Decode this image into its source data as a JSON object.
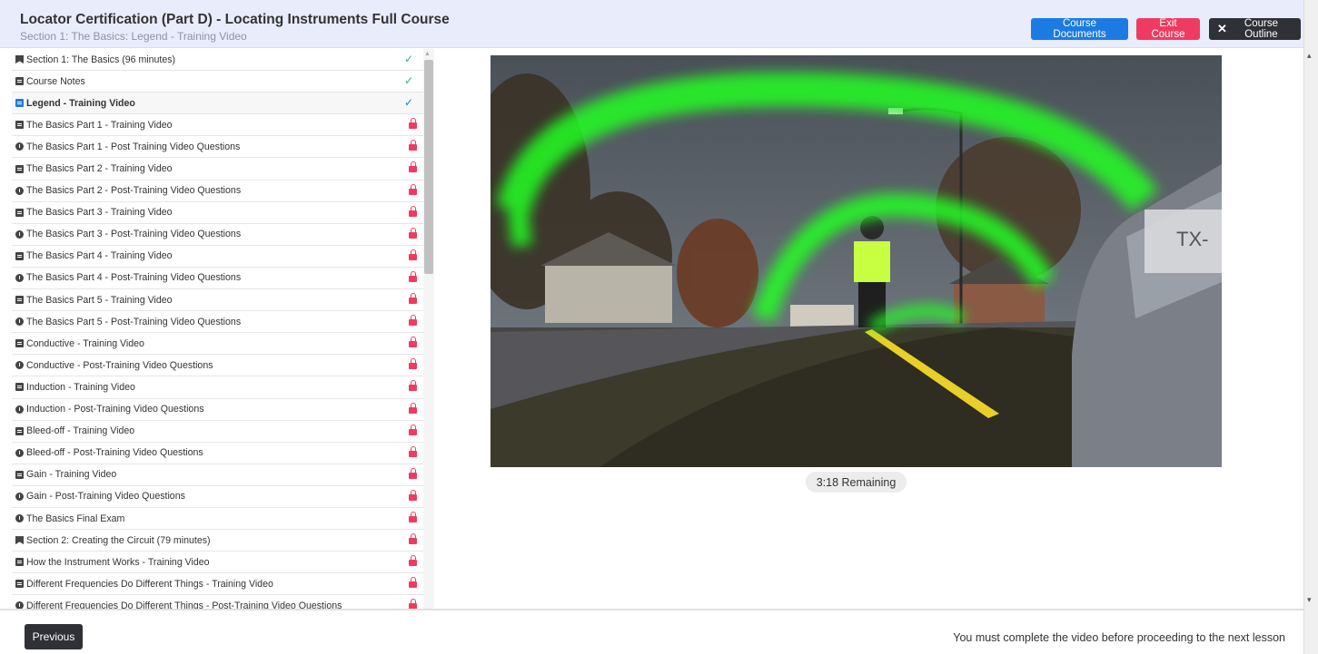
{
  "header": {
    "title": "Locator Certification (Part D) - Locating Instruments Full Course",
    "subtitle": "Section 1: The Basics: Legend - Training Video",
    "course_documents_label": "Course Documents",
    "exit_course_label": "Exit Course",
    "course_outline_label": "Course Outline"
  },
  "lessons": [
    {
      "label": "Section 1: The Basics (96 minutes)",
      "icon": "flag",
      "status": "check"
    },
    {
      "label": "Course Notes",
      "icon": "doc",
      "status": "check"
    },
    {
      "label": "Legend - Training Video",
      "icon": "doc",
      "status": "current"
    },
    {
      "label": "The Basics Part 1 - Training Video",
      "icon": "doc",
      "status": "locked"
    },
    {
      "label": "The Basics Part 1 - Post Training Video Questions",
      "icon": "quiz",
      "status": "locked"
    },
    {
      "label": "The Basics Part 2 - Training Video",
      "icon": "doc",
      "status": "locked"
    },
    {
      "label": "The Basics Part 2 - Post-Training Video Questions",
      "icon": "quiz",
      "status": "locked"
    },
    {
      "label": "The Basics Part 3 - Training Video",
      "icon": "doc",
      "status": "locked"
    },
    {
      "label": "The Basics Part 3 - Post-Training Video Questions",
      "icon": "quiz",
      "status": "locked"
    },
    {
      "label": "The Basics Part 4 - Training Video",
      "icon": "doc",
      "status": "locked"
    },
    {
      "label": "The Basics Part 4 - Post-Training Video Questions",
      "icon": "quiz",
      "status": "locked"
    },
    {
      "label": "The Basics Part 5 - Training Video",
      "icon": "doc",
      "status": "locked"
    },
    {
      "label": "The Basics Part 5 - Post-Training Video Questions",
      "icon": "quiz",
      "status": "locked"
    },
    {
      "label": "Conductive - Training Video",
      "icon": "doc",
      "status": "locked"
    },
    {
      "label": "Conductive - Post-Training Video Questions",
      "icon": "quiz",
      "status": "locked"
    },
    {
      "label": "Induction - Training Video",
      "icon": "doc",
      "status": "locked"
    },
    {
      "label": "Induction - Post-Training Video Questions",
      "icon": "quiz",
      "status": "locked"
    },
    {
      "label": "Bleed-off - Training Video",
      "icon": "doc",
      "status": "locked"
    },
    {
      "label": "Bleed-off - Post-Training Video Questions",
      "icon": "quiz",
      "status": "locked"
    },
    {
      "label": "Gain - Training Video",
      "icon": "doc",
      "status": "locked"
    },
    {
      "label": "Gain - Post-Training Video Questions",
      "icon": "quiz",
      "status": "locked"
    },
    {
      "label": "The Basics Final Exam",
      "icon": "quiz",
      "status": "locked"
    },
    {
      "label": "Section 2: Creating the Circuit (79 minutes)",
      "icon": "flag",
      "status": "locked"
    },
    {
      "label": "How the Instrument Works - Training Video",
      "icon": "doc",
      "status": "locked"
    },
    {
      "label": "Different Frequencies Do Different Things - Training Video",
      "icon": "doc",
      "status": "locked"
    },
    {
      "label": "Different Frequencies Do Different Things - Post-Training Video Questions",
      "icon": "quiz",
      "status": "locked"
    }
  ],
  "video": {
    "remaining": "3:18 Remaining",
    "transmitter_label": "TX-"
  },
  "footer": {
    "previous_label": "Previous",
    "message": "You must complete the video before proceeding to the next lesson"
  },
  "colors": {
    "primary": "#1b7be3",
    "danger": "#ee3c60",
    "dark": "#2f3136",
    "success": "#2eb67a",
    "header_bg": "#e9ecfb"
  }
}
